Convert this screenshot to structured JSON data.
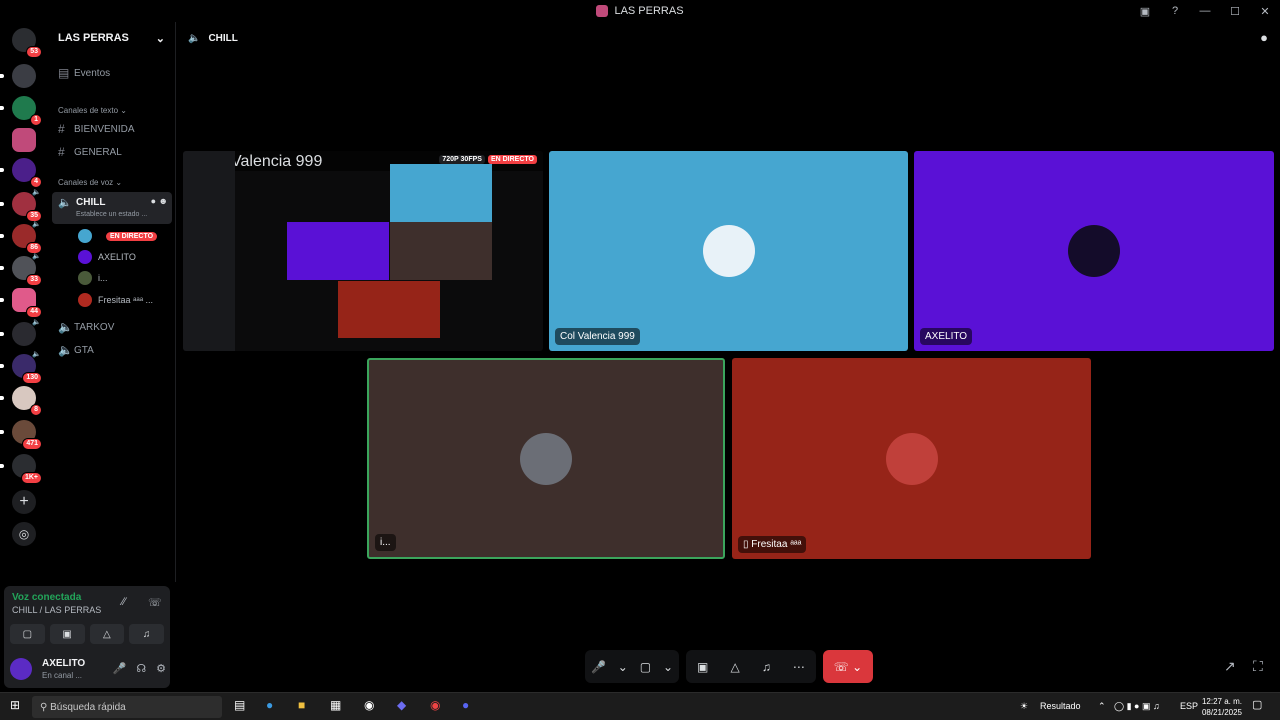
{
  "window": {
    "title": "LAS PERRAS",
    "controls": [
      "—",
      "☐",
      "✕"
    ]
  },
  "servers": {
    "home_badge": "53",
    "badges": [
      "1",
      "4",
      "35",
      "86",
      "33",
      "44",
      "130",
      "8",
      "471",
      "1K+"
    ]
  },
  "guild": {
    "name": "LAS PERRAS",
    "events_label": "Eventos",
    "text_category": "Canales de texto",
    "text_channels": [
      "BIENVENIDA",
      "GENERAL"
    ],
    "voice_category": "Canales de voz",
    "active_voice": {
      "name": "CHILL",
      "status": "Establece un estado ..."
    },
    "voice_users": [
      {
        "name": "",
        "live": "EN DIRECTO"
      },
      {
        "name": "AXELITO"
      },
      {
        "name": "i..."
      },
      {
        "name": "Fresitaa ᵃᵃᵃ ..."
      }
    ],
    "other_voice_channels": [
      "TARKOV",
      "GTA"
    ]
  },
  "voice_panel": {
    "status": "Voz conectada",
    "location": "CHILL / LAS PERRAS",
    "user": {
      "name": "AXELITO",
      "status": "En canal ..."
    }
  },
  "header": {
    "channel": "CHILL"
  },
  "stream": {
    "quality": "720P 30FPS",
    "live": "EN DIRECTO",
    "owner": "Col Valencia 999"
  },
  "tiles": [
    {
      "name": "Col Valencia 999",
      "color": "#46a6d0"
    },
    {
      "name": "AXELITO",
      "color": "#5a11d6"
    },
    {
      "name": "i...",
      "color": "#3e2f2c"
    },
    {
      "name": "Fresitaa ᵃᵃᵃ",
      "color": "#962418"
    }
  ],
  "taskbar": {
    "search_placeholder": "Búsqueda rápida",
    "weather": "Resultado",
    "lang": "ESP",
    "time": "12:27 a. m.",
    "date": "08/21/2025"
  },
  "colors": {
    "accent_green": "#23a55a",
    "live_red": "#f23f43",
    "hangup_red": "#da373c"
  }
}
